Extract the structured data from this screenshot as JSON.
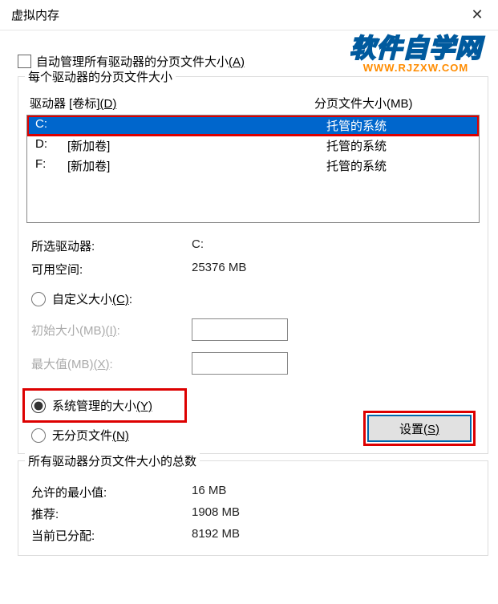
{
  "title": "虚拟内存",
  "auto_manage": "自动管理所有驱动器的分页文件大小",
  "auto_manage_key": "(A)",
  "group1": {
    "label": "每个驱动器的分页文件大小",
    "col_drive_label": "驱动器 [卷标]",
    "col_drive_key": "(D)",
    "col_size": "分页文件大小(MB)",
    "rows": [
      {
        "letter": "C:",
        "label": "",
        "size": "托管的系统",
        "selected": true
      },
      {
        "letter": "D:",
        "label": "[新加卷]",
        "size": "托管的系统",
        "selected": false
      },
      {
        "letter": "F:",
        "label": "[新加卷]",
        "size": "托管的系统",
        "selected": false
      }
    ],
    "selected_drive_label": "所选驱动器:",
    "selected_drive_value": "C:",
    "free_space_label": "可用空间:",
    "free_space_value": "25376 MB",
    "custom_label": "自定义大小",
    "custom_key": "(C)",
    "initial_label": "初始大小(MB)",
    "initial_key": "(I)",
    "max_label": "最大值(MB)",
    "max_key": "(X)",
    "system_label": "系统管理的大小",
    "system_key": "(Y)",
    "none_label": "无分页文件",
    "none_key": "(N)",
    "set_button": "设置",
    "set_key": "(S)"
  },
  "group2": {
    "label": "所有驱动器分页文件大小的总数",
    "min_label": "允许的最小值:",
    "min_value": "16 MB",
    "rec_label": "推荐:",
    "rec_value": "1908 MB",
    "cur_label": "当前已分配:",
    "cur_value": "8192 MB"
  },
  "watermark": {
    "line1": "软件自学网",
    "line2": "WWW.RJZXW.COM"
  }
}
